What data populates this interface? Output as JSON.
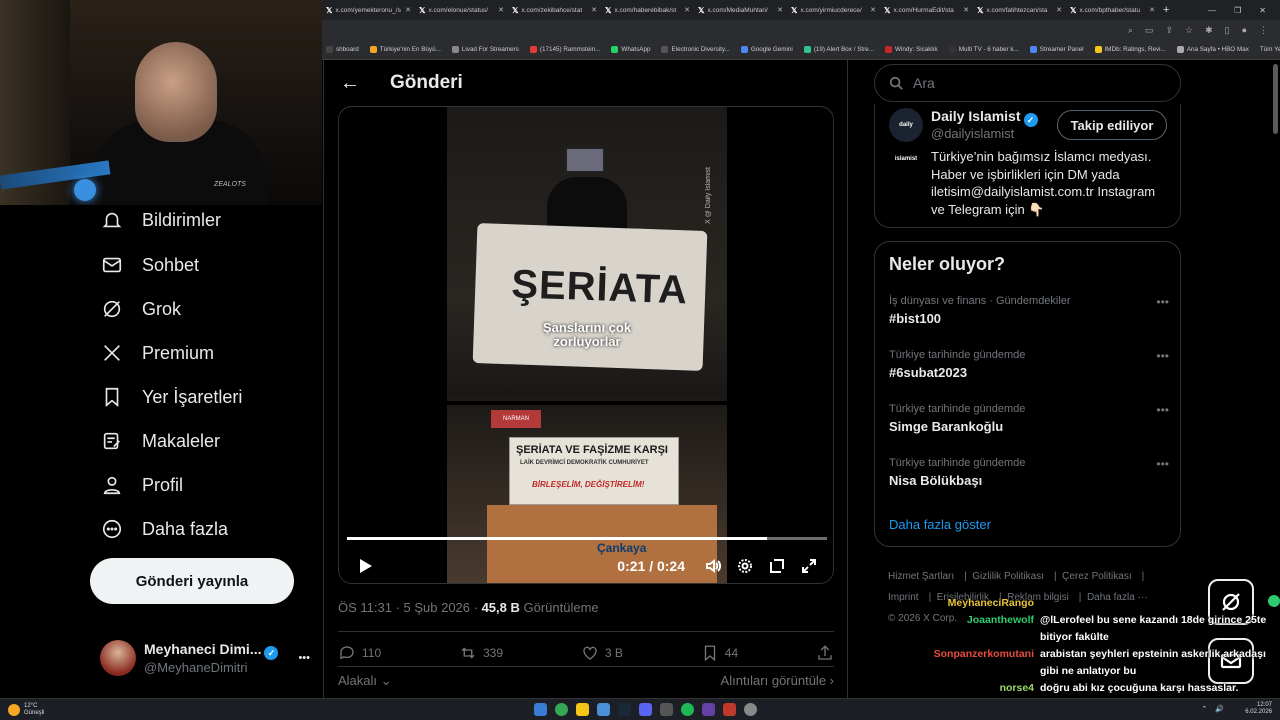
{
  "browser": {
    "tabs": [
      {
        "title": "x.com/yemekteronu_/s"
      },
      {
        "title": "x.com/elonue/status/"
      },
      {
        "title": "x.com/zekibahce/stat"
      },
      {
        "title": "x.com/haberebibak/st"
      },
      {
        "title": "x.com/MediaMuhtari/"
      },
      {
        "title": "x.com/yirmiucderece/"
      },
      {
        "title": "x.com/HurmaEdit/sta"
      },
      {
        "title": "x.com/fatihtezcan/sta"
      },
      {
        "title": "x.com/bpthaber/statu"
      }
    ],
    "bookmarks": [
      {
        "label": "shboard",
        "color": "#444"
      },
      {
        "label": "Türkiye'nin En Büyü...",
        "color": "#f5a623"
      },
      {
        "label": "Livad For Streamers",
        "color": "#888"
      },
      {
        "label": "(17145) Rammstein...",
        "color": "#e53935"
      },
      {
        "label": "WhatsApp",
        "color": "#25d366"
      },
      {
        "label": "Electronic Diversity...",
        "color": "#555"
      },
      {
        "label": "Google Gemini",
        "color": "#4f86f7"
      },
      {
        "label": "(19) Alert Box / Stre...",
        "color": "#31c48d"
      },
      {
        "label": "Windy: Sicaklık",
        "color": "#c62828"
      },
      {
        "label": "Multi TV - 6 haber k...",
        "color": "#333"
      },
      {
        "label": "Streamer Panel",
        "color": "#4f86f7"
      },
      {
        "label": "IMDb: Ratings, Revi...",
        "color": "#f5c518"
      },
      {
        "label": "Ana Sayfa • HBO Max",
        "color": "#aaa"
      }
    ],
    "all_bookmarks": "Tüm Yer İşaretleri"
  },
  "sidebar": {
    "items": [
      {
        "label": "Bildirimler",
        "icon": "bell-icon"
      },
      {
        "label": "Sohbet",
        "icon": "mail-icon"
      },
      {
        "label": "Grok",
        "icon": "grok-icon"
      },
      {
        "label": "Premium",
        "icon": "x-logo-icon"
      },
      {
        "label": "Yer İşaretleri",
        "icon": "bookmark-icon"
      },
      {
        "label": "Makaleler",
        "icon": "article-icon"
      },
      {
        "label": "Profil",
        "icon": "person-icon"
      },
      {
        "label": "Daha fazla",
        "icon": "more-circle-icon"
      }
    ],
    "post_button": "Gönderi yayınla",
    "account": {
      "name": "Meyhaneci Dimi...",
      "handle": "@MeyhaneDimitri",
      "more": "•••"
    }
  },
  "header": {
    "title": "Gönderi",
    "back": "←"
  },
  "video": {
    "caption_line1": "Şanslarını çok",
    "caption_line2": "zorluyorlar",
    "banner_text": "ŞERİATA",
    "sign_text": "NARMAN",
    "banner2_line1": "ŞERİATA VE FAŞİZME KARŞI",
    "banner2_line2": "LAİK DEVRİMCİ DEMOKRATİK CUMHURİYET",
    "banner2_line3": "BİRLEŞELİM, DEĞİŞTİRELİM!",
    "wall_brand": "Çankaya",
    "watermark": "X @ Daily Islamist",
    "time": "0:21 / 0:24",
    "progress": 0.875
  },
  "post_meta": {
    "time": "ÖS 11:31 · 5 Şub 2026 · ",
    "views": "45,8 B",
    "views_label": " Görüntüleme"
  },
  "actions": {
    "replies": "110",
    "reposts": "339",
    "likes": "3 B",
    "bookmarks": "44"
  },
  "bottom": {
    "relevance": "Alakalı ⌄",
    "quotes": "Alıntıları görüntüle ›"
  },
  "search": {
    "placeholder": "Ara"
  },
  "profile_card": {
    "name": "Daily Islamist",
    "handle": "@dailyislamist",
    "follow_label": "Takip ediliyor",
    "avatar_text": "daily islamist",
    "bio": "Türkiye’nin bağımsız İslamcı medyası. Haber ve işbirlikleri için DM yada iletisim@dailyislamist.com.tr Instagram ve Telegram için 👇🏻"
  },
  "trends": {
    "title": "Neler oluyor?",
    "items": [
      {
        "context": "İş dünyası ve finans · Gündemdekiler",
        "topic": "#bist100"
      },
      {
        "context": "Türkiye tarihinde gündemde",
        "topic": "#6subat2023"
      },
      {
        "context": "Türkiye tarihinde gündemde",
        "topic": "Simge Barankoğlu"
      },
      {
        "context": "Türkiye tarihinde gündemde",
        "topic": "Nisa Bölükbaşı"
      }
    ],
    "show_more": "Daha fazla göster"
  },
  "footer": {
    "links": [
      "Hizmet Şartları",
      "Gizlilik Politikası",
      "Çerez Politikası",
      "Imprint",
      "Erişilebilirlik",
      "Reklam bilgisi",
      "Daha fazla ···"
    ],
    "copyright": "© 2026 X Corp."
  },
  "chat": [
    {
      "user": "MeyhaneciRango",
      "color": "#e8c33b",
      "message": ""
    },
    {
      "user": "Joaanthewolf",
      "color": "#2ecc71",
      "message": "@lLerofeel bu sene kazandı 18de girince 25te bitiyor fakülte"
    },
    {
      "user": "Sonpanzerkomutani",
      "color": "#e74c3c",
      "message": "arabistan şeyhleri epsteinin askerlik arkadaşı gibi ne anlatıyor bu"
    },
    {
      "user": "norse4",
      "color": "#9bd86b",
      "message": "doğru abi kız çocuğuna karşı hassaslar. kimsesiz erkek çocuğu seviyor bunlar"
    }
  ],
  "taskbar": {
    "weather_temp": "12°C",
    "weather_desc": "Güneşli",
    "time": "12:07",
    "date": "6.02.2026"
  }
}
